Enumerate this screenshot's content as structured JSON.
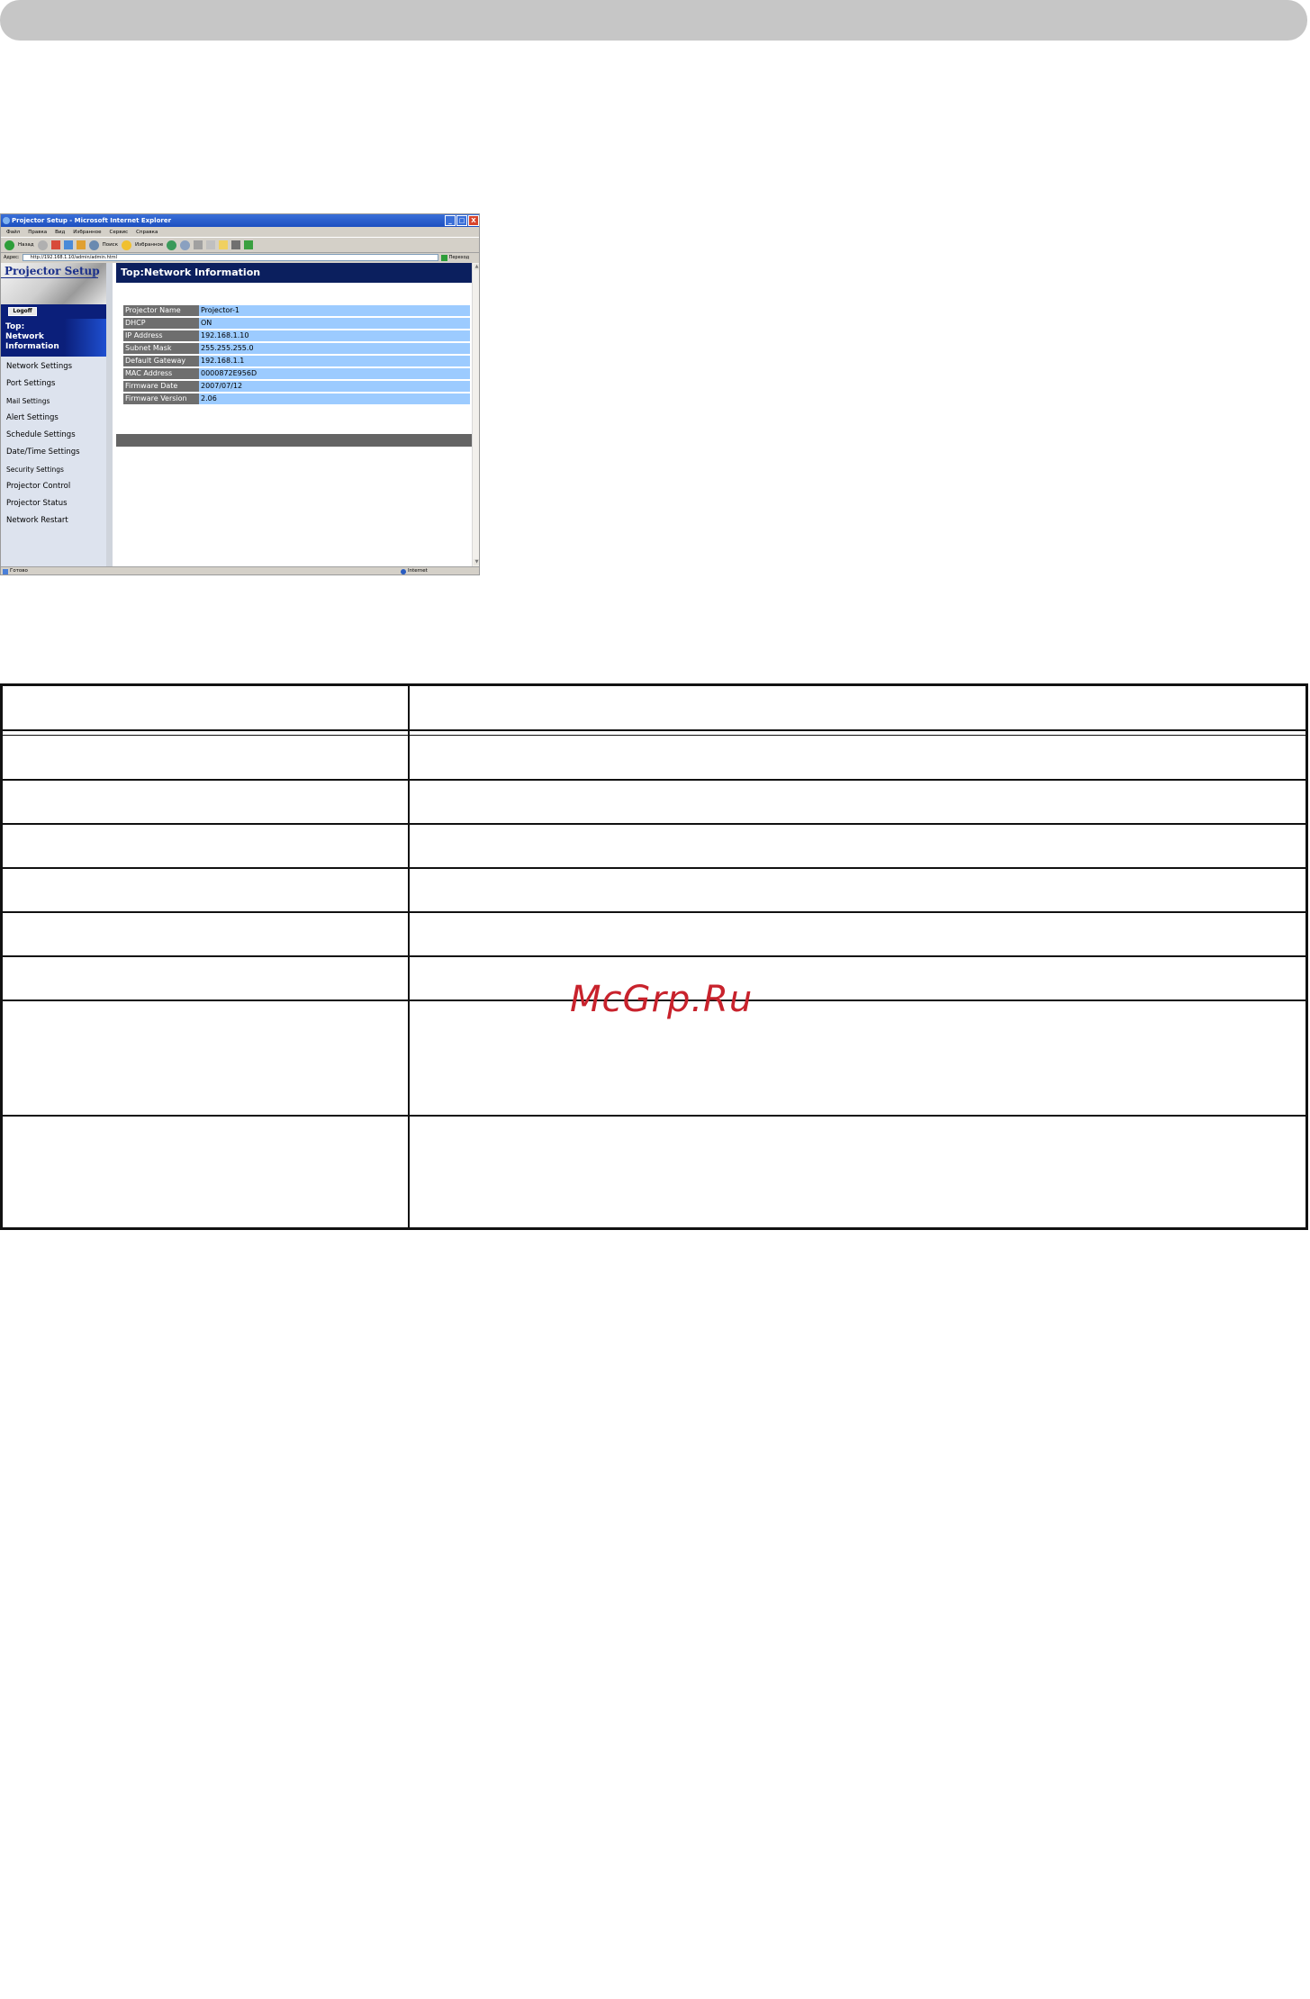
{
  "browser": {
    "title": "Projector Setup - Microsoft Internet Explorer",
    "window_buttons": [
      "_",
      "□",
      "X"
    ],
    "menu": [
      "Файл",
      "Правка",
      "Вид",
      "Избранное",
      "Сервис",
      "Справка"
    ],
    "toolbar": {
      "back_label": "Назад",
      "search_label": "Поиск",
      "favorites_label": "Избранное"
    },
    "address_label": "Адрес:",
    "address_value": "http://192.168.1.10/admin/admin.html",
    "go_label": "Переход",
    "status_left": "Готово",
    "status_right": "Internet"
  },
  "sidebar": {
    "logo": "Projector Setup",
    "logoff_label": "Logoff",
    "active_item": [
      "Top:",
      "Network",
      "Information"
    ],
    "items": [
      "Network Settings",
      "Port Settings",
      "Mail Settings",
      "Alert Settings",
      "Schedule Settings",
      "Date/Time Settings",
      "Security Settings",
      "Projector Control",
      "Projector Status",
      "Network Restart"
    ]
  },
  "content": {
    "title": "Top:Network Information",
    "rows": [
      {
        "label": "Projector Name",
        "value": "Projector-1"
      },
      {
        "label": "DHCP",
        "value": "ON"
      },
      {
        "label": "IP Address",
        "value": "192.168.1.10"
      },
      {
        "label": "Subnet Mask",
        "value": "255.255.255.0"
      },
      {
        "label": "Default Gateway",
        "value": "192.168.1.1"
      },
      {
        "label": "MAC Address",
        "value": "0000872E956D"
      },
      {
        "label": "Firmware Date",
        "value": "2007/07/12"
      },
      {
        "label": "Firmware Version",
        "value": "2.06"
      }
    ]
  },
  "watermark": "McGrp.Ru"
}
